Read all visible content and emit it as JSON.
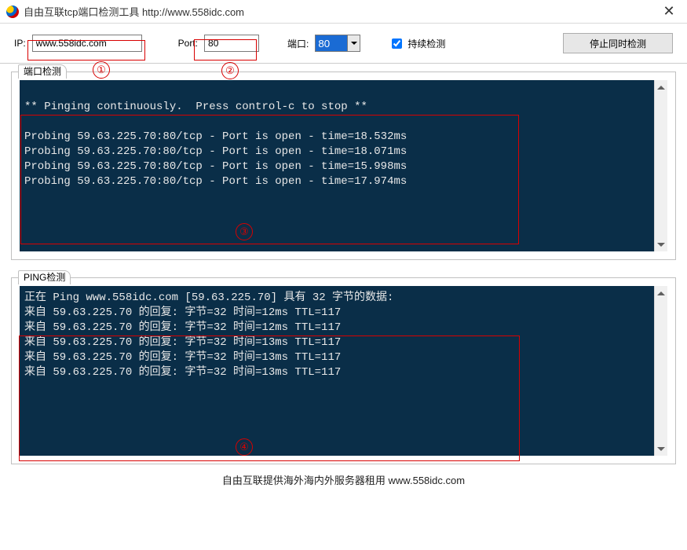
{
  "window": {
    "title": "自由互联tcp端口检测工具 http://www.558idc.com",
    "close": "✕"
  },
  "toolbar": {
    "ip_label": "IP:",
    "ip_value": "www.558idc.com",
    "port_text_label": "Port:",
    "port_text_value": "80",
    "port_combo_label": "端口:",
    "port_combo_value": "80",
    "continuous_label": "持续检测",
    "continuous_checked": true,
    "stop_button": "停止同时检测"
  },
  "annotations": {
    "c1": "①",
    "c2": "②",
    "c3": "③",
    "c4": "④"
  },
  "panel1": {
    "legend": "端口检测",
    "lines": [
      "",
      "** Pinging continuously.  Press control-c to stop **",
      "",
      "Probing 59.63.225.70:80/tcp - Port is open - time=18.532ms",
      "Probing 59.63.225.70:80/tcp - Port is open - time=18.071ms",
      "Probing 59.63.225.70:80/tcp - Port is open - time=15.998ms",
      "Probing 59.63.225.70:80/tcp - Port is open - time=17.974ms"
    ]
  },
  "panel2": {
    "legend": "PING检测",
    "lines": [
      "正在 Ping www.558idc.com [59.63.225.70] 具有 32 字节的数据:",
      "来自 59.63.225.70 的回复: 字节=32 时间=12ms TTL=117",
      "来自 59.63.225.70 的回复: 字节=32 时间=12ms TTL=117",
      "来自 59.63.225.70 的回复: 字节=32 时间=13ms TTL=117",
      "来自 59.63.225.70 的回复: 字节=32 时间=13ms TTL=117",
      "来自 59.63.225.70 的回复: 字节=32 时间=13ms TTL=117"
    ]
  },
  "footer": "自由互联提供海外海内外服务器租用 www.558idc.com"
}
